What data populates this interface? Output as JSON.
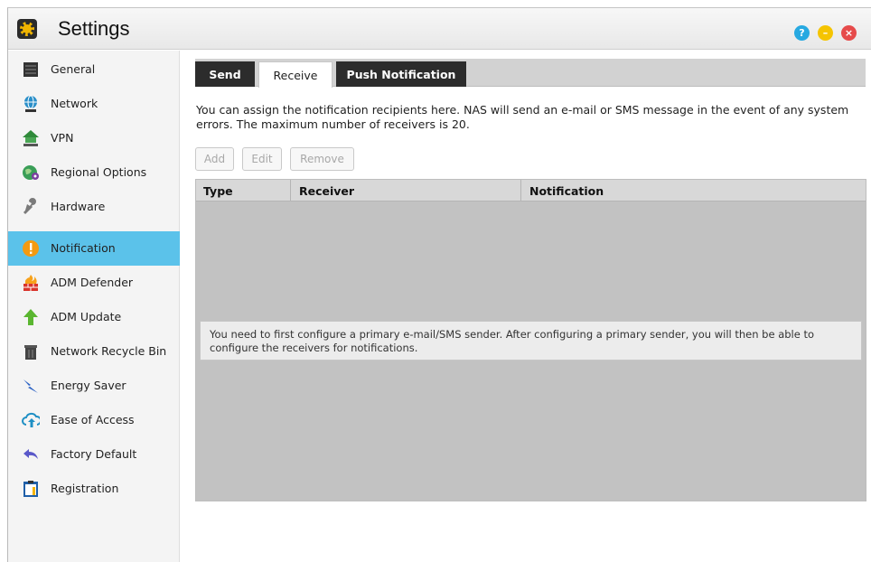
{
  "window": {
    "title": "Settings"
  },
  "window_controls": {
    "help": "?",
    "minimize": "–",
    "close": "×"
  },
  "sidebar": {
    "items": [
      {
        "label": "General",
        "icon": "server-icon"
      },
      {
        "label": "Network",
        "icon": "globe-network-icon"
      },
      {
        "label": "VPN",
        "icon": "vpn-house-icon"
      },
      {
        "label": "Regional Options",
        "icon": "globe-location-icon"
      },
      {
        "label": "Hardware",
        "icon": "wrench-icon"
      },
      {
        "label": "Notification",
        "icon": "alert-icon",
        "active": true
      },
      {
        "label": "ADM Defender",
        "icon": "firewall-icon"
      },
      {
        "label": "ADM Update",
        "icon": "up-arrow-icon"
      },
      {
        "label": "Network Recycle Bin",
        "icon": "trash-icon"
      },
      {
        "label": "Energy Saver",
        "icon": "lightning-icon"
      },
      {
        "label": "Ease of Access",
        "icon": "cloud-upload-icon"
      },
      {
        "label": "Factory Default",
        "icon": "undo-arrow-icon"
      },
      {
        "label": "Registration",
        "icon": "clipboard-icon"
      }
    ]
  },
  "tabs": [
    {
      "label": "Send",
      "selected": false
    },
    {
      "label": "Receive",
      "selected": true
    },
    {
      "label": "Push Notification",
      "selected": false
    }
  ],
  "description": "You can assign the notification recipients here. NAS will send an e-mail or SMS message in the event of any system errors. The maximum number of receivers is 20.",
  "toolbar": {
    "add_label": "Add",
    "edit_label": "Edit",
    "remove_label": "Remove"
  },
  "table": {
    "columns": [
      "Type",
      "Receiver",
      "Notification"
    ],
    "rows": [],
    "notice": "You need to first configure a primary e-mail/SMS sender. After configuring a primary sender, you will then be able to configure the receivers for notifications."
  },
  "colors": {
    "active_item": "#5bc2ea",
    "tab_dark": "#2c2c2c",
    "table_body": "#c2c2c2"
  }
}
